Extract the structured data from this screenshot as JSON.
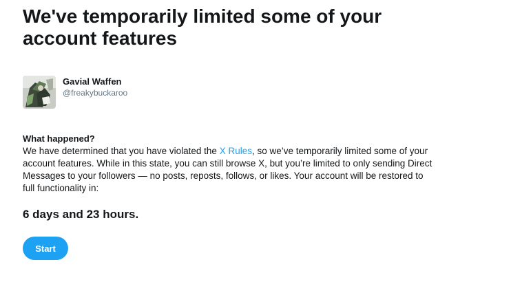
{
  "headline": "We've temporarily limited some of your account features",
  "profile": {
    "display_name": "Gavial Waffen",
    "handle": "@freakybuckaroo"
  },
  "what_happened": {
    "title": "What happened?",
    "text_before_link": "We have determined that you have violated the ",
    "link_text": "X Rules",
    "text_after_link": ", so we’ve temporarily limited some of your account features. While in this state, you can still browse X, but you’re limited to only sending Direct Messages to your followers — no posts, reposts, follows, or likes. Your account will be restored to full functionality in:"
  },
  "countdown": "6 days and 23 hours.",
  "start_button": "Start",
  "colors": {
    "accent": "#1da1f2",
    "text": "#14171a",
    "secondary_text": "#657786"
  }
}
